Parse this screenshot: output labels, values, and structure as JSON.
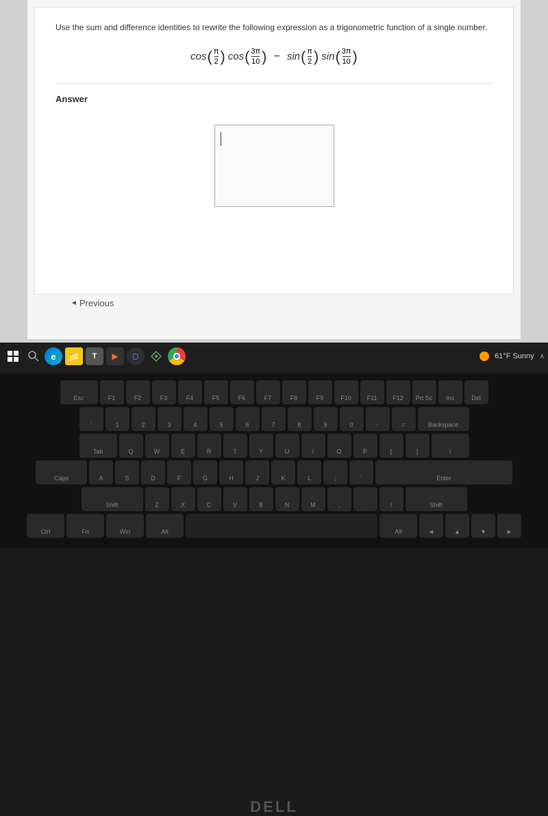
{
  "page": {
    "question": "Use the sum and difference identities to rewrite the following expression as a trigonometric function of a single number.",
    "answer_label": "Answer",
    "previous_button": "Previous"
  },
  "math": {
    "expression": "cos(π/2)cos(3π/10) − sin(π/2)sin(3π/10)"
  },
  "taskbar": {
    "weather": "61°F Sunny"
  },
  "dell": {
    "logo": "DELL"
  }
}
